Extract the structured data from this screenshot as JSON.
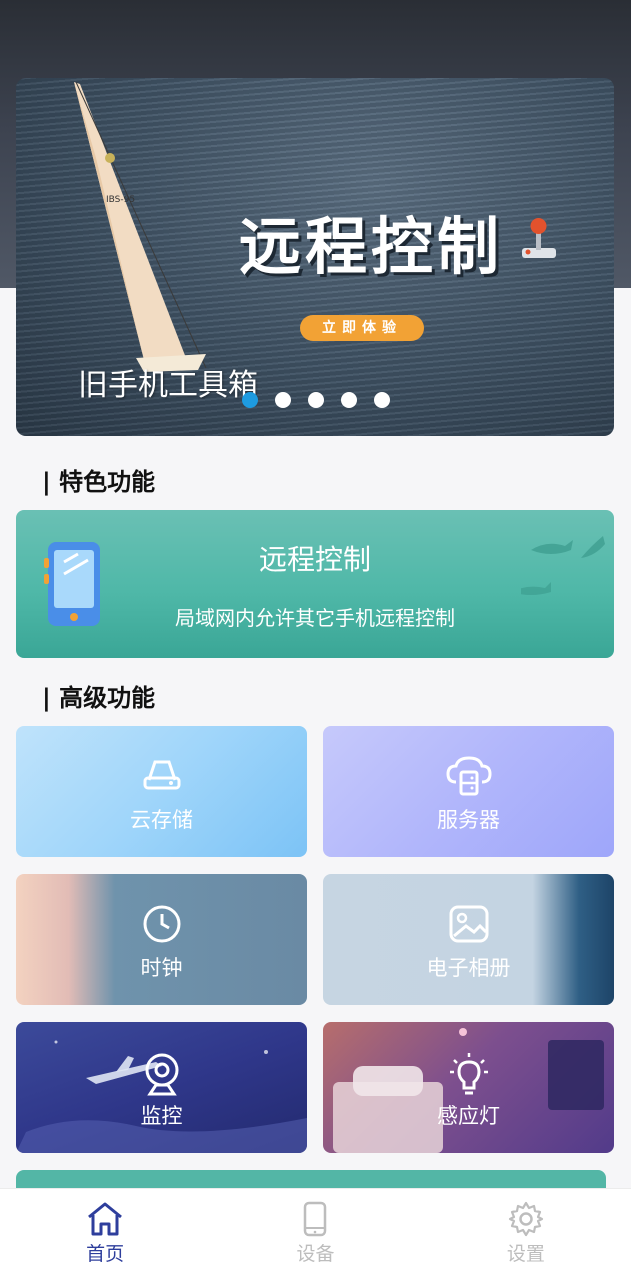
{
  "banner": {
    "title": "远程控制",
    "cta": "立即体验",
    "caption": "旧手机工具箱",
    "dots": 5,
    "active_dot": 0,
    "sail_number": "IBS-95"
  },
  "sections": {
    "featured": "| 特色功能",
    "advanced": "| 高级功能"
  },
  "feature_card": {
    "title": "远程控制",
    "subtitle": "局域网内允许其它手机远程控制"
  },
  "tiles": [
    {
      "label": "云存储",
      "icon": "cloud-storage-icon"
    },
    {
      "label": "服务器",
      "icon": "server-icon"
    },
    {
      "label": "时钟",
      "icon": "clock-icon"
    },
    {
      "label": "电子相册",
      "icon": "photo-album-icon"
    },
    {
      "label": "监控",
      "icon": "camera-icon"
    },
    {
      "label": "感应灯",
      "icon": "light-bulb-icon"
    }
  ],
  "nav": {
    "items": [
      {
        "label": "首页",
        "icon": "home-icon",
        "active": true
      },
      {
        "label": "设备",
        "icon": "device-icon",
        "active": false
      },
      {
        "label": "设置",
        "icon": "gear-icon",
        "active": false
      }
    ]
  },
  "colors": {
    "accent": "#2e3e9c",
    "active_dot": "#1e9be0",
    "cta": "#f2a235",
    "feature_card": "#4fb8a8"
  }
}
